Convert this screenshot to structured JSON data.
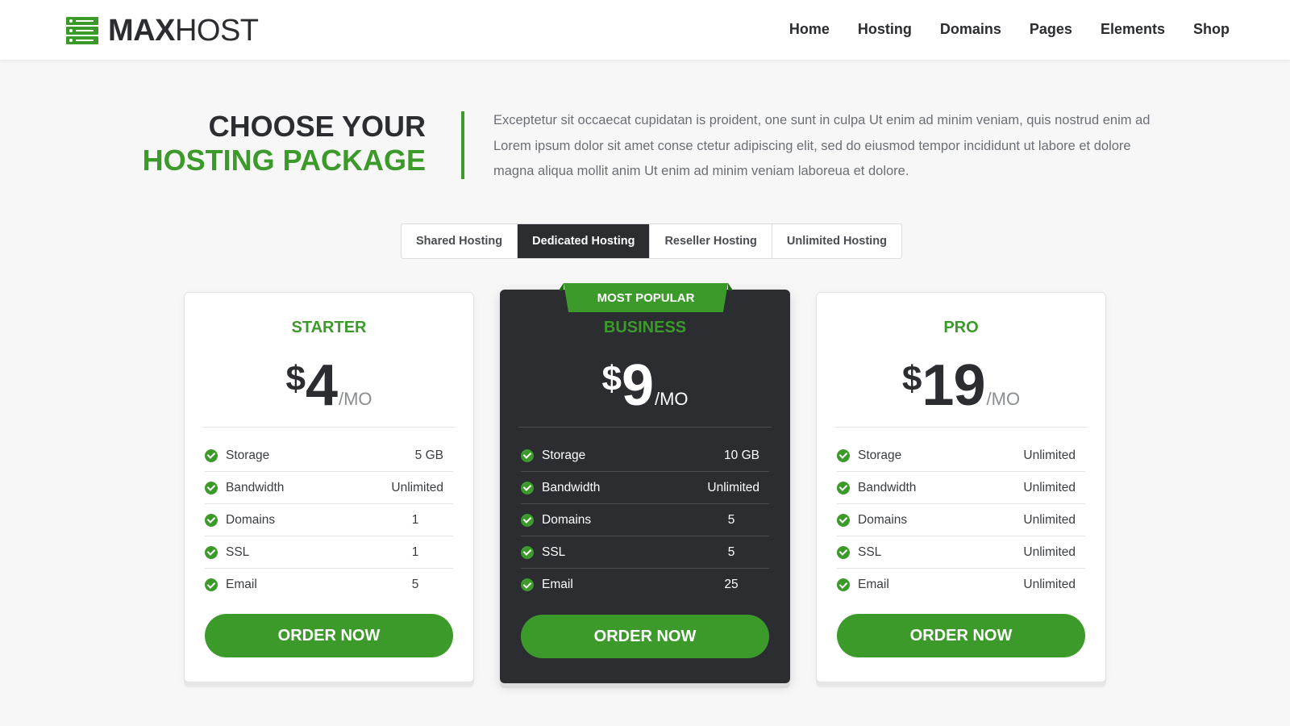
{
  "brand": {
    "bold": "MAX",
    "light": "HOST"
  },
  "nav": [
    "Home",
    "Hosting",
    "Domains",
    "Pages",
    "Elements",
    "Shop"
  ],
  "intro": {
    "title_line1": "CHOOSE YOUR",
    "title_line2": "HOSTING PACKAGE",
    "text": "Exceptetur sit occaecat cupidatan is proident, one sunt in culpa Ut enim ad minim veniam, quis nostrud enim ad Lorem ipsum dolor sit amet conse ctetur adipiscing elit, sed do eiusmod tempor incididunt ut labore et dolore magna aliqua mollit anim Ut enim ad minim veniam laboreua et dolore."
  },
  "tabs": [
    "Shared Hosting",
    "Dedicated Hosting",
    "Reseller Hosting",
    "Unlimited Hosting"
  ],
  "active_tab": "Dedicated Hosting",
  "colors": {
    "accent": "#3c9a2a",
    "dark": "#2b2d31"
  },
  "plans": [
    {
      "name": "STARTER",
      "currency": "$",
      "price": "4",
      "period": "/MO",
      "features": [
        {
          "label": "Storage",
          "value": "5 GB"
        },
        {
          "label": "Bandwidth",
          "value": "Unlimited"
        },
        {
          "label": "Domains",
          "value": "1"
        },
        {
          "label": "SSL",
          "value": "1"
        },
        {
          "label": "Email",
          "value": "5"
        }
      ],
      "button": "ORDER NOW"
    },
    {
      "name": "BUSINESS",
      "badge": "MOST POPULAR",
      "currency": "$",
      "price": "9",
      "period": "/MO",
      "features": [
        {
          "label": "Storage",
          "value": "10 GB"
        },
        {
          "label": "Bandwidth",
          "value": "Unlimited"
        },
        {
          "label": "Domains",
          "value": "5"
        },
        {
          "label": "SSL",
          "value": "5"
        },
        {
          "label": "Email",
          "value": "25"
        }
      ],
      "button": "ORDER NOW"
    },
    {
      "name": "PRO",
      "currency": "$",
      "price": "19",
      "period": "/MO",
      "features": [
        {
          "label": "Storage",
          "value": "Unlimited"
        },
        {
          "label": "Bandwidth",
          "value": "Unlimited"
        },
        {
          "label": "Domains",
          "value": "Unlimited"
        },
        {
          "label": "SSL",
          "value": "Unlimited"
        },
        {
          "label": "Email",
          "value": "Unlimited"
        }
      ],
      "button": "ORDER NOW"
    }
  ]
}
